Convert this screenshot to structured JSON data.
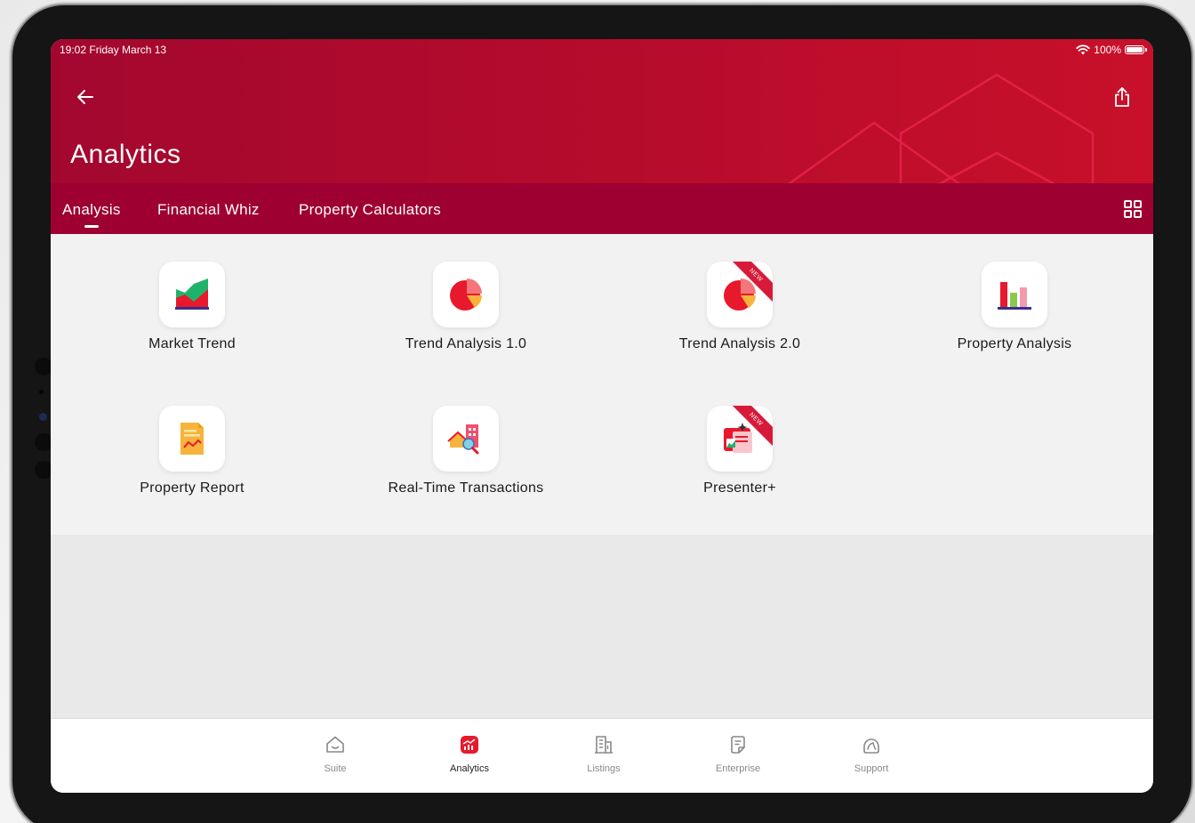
{
  "status_bar": {
    "time_date": "19:02  Friday March 13",
    "battery": "100%"
  },
  "header": {
    "title": "Analytics"
  },
  "tabs": [
    {
      "label": "Analysis",
      "active": true
    },
    {
      "label": "Financial Whiz",
      "active": false
    },
    {
      "label": "Property Calculators",
      "active": false
    }
  ],
  "tiles": [
    {
      "label": "Market Trend",
      "icon": "market-trend-icon",
      "new": false
    },
    {
      "label": "Trend Analysis 1.0",
      "icon": "pie-chart-icon",
      "new": false
    },
    {
      "label": "Trend Analysis 2.0",
      "icon": "pie-chart-icon",
      "new": true,
      "badge": "NEW"
    },
    {
      "label": "Property Analysis",
      "icon": "bar-chart-icon",
      "new": false
    },
    {
      "label": "Property Report",
      "icon": "report-icon",
      "new": false
    },
    {
      "label": "Real-Time Transactions",
      "icon": "transactions-icon",
      "new": false
    },
    {
      "label": "Presenter+",
      "icon": "presenter-icon",
      "new": true,
      "badge": "NEW"
    }
  ],
  "bottom_nav": [
    {
      "label": "Suite",
      "icon": "home-icon",
      "active": false
    },
    {
      "label": "Analytics",
      "icon": "analytics-icon",
      "active": true
    },
    {
      "label": "Listings",
      "icon": "building-icon",
      "active": false
    },
    {
      "label": "Enterprise",
      "icon": "document-icon",
      "active": false
    },
    {
      "label": "Support",
      "icon": "support-icon",
      "active": false
    }
  ],
  "colors": {
    "brand_red": "#b70c2c",
    "tab_bar": "#9e0031",
    "accent": "#d81a3a"
  }
}
